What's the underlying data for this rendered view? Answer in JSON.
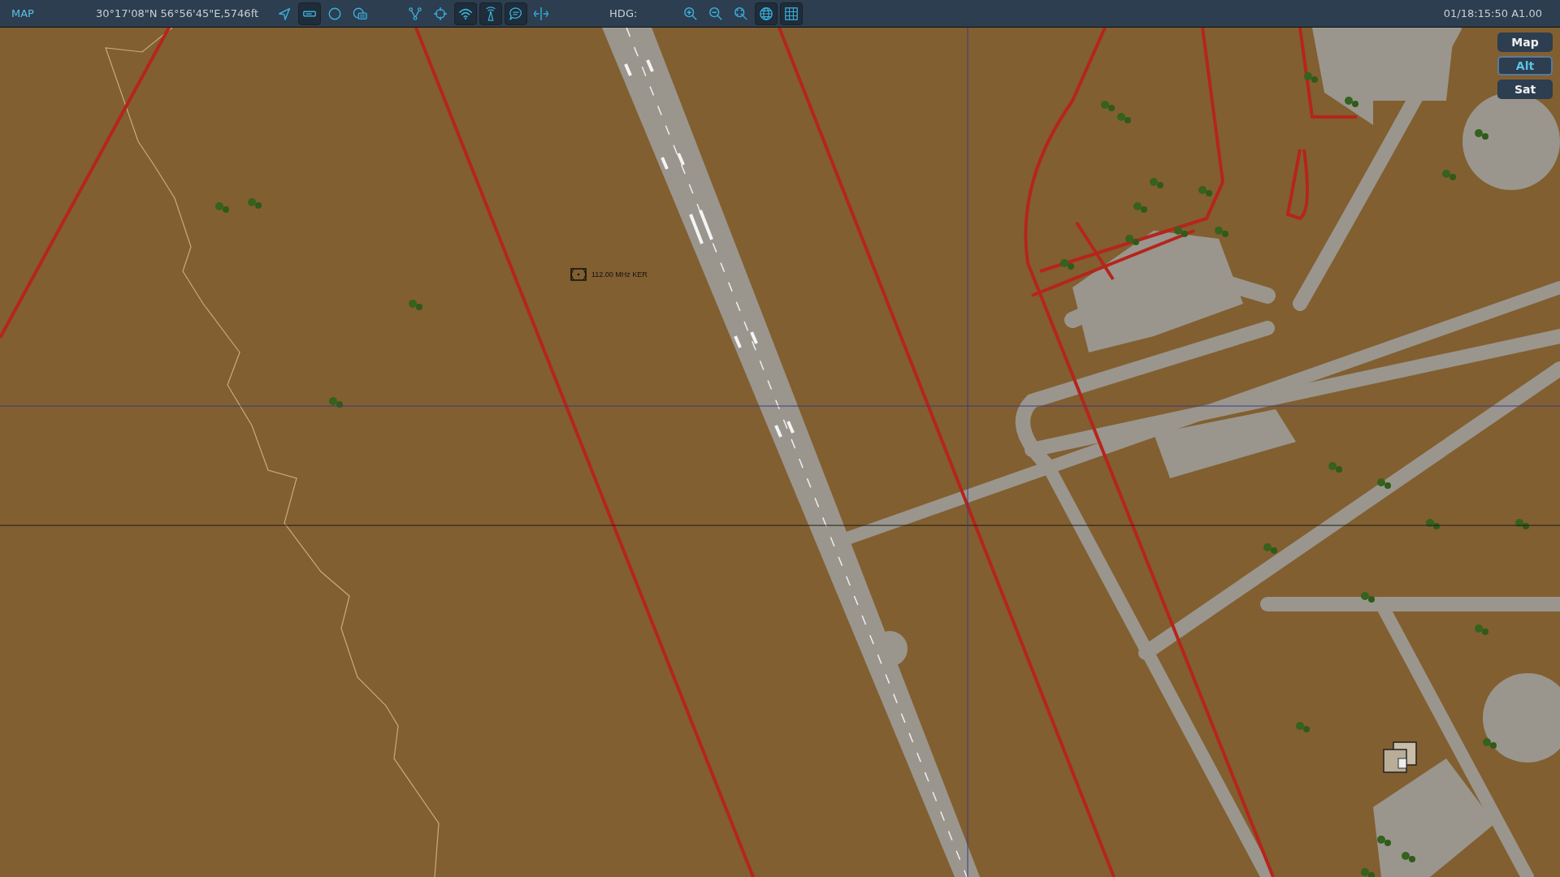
{
  "toolbar": {
    "title": "MAP",
    "coordinates": "30°17'08\"N 56°56'45\"E,5746ft",
    "tools": [
      {
        "kind": "navigate",
        "on": false
      },
      {
        "kind": "ruler",
        "on": true
      },
      {
        "kind": "circle",
        "on": false
      },
      {
        "kind": "layers",
        "on": false
      },
      {
        "kind": "branch",
        "on": false
      },
      {
        "kind": "crosshair",
        "on": false
      },
      {
        "kind": "wifi",
        "on": true
      },
      {
        "kind": "tower",
        "on": true
      },
      {
        "kind": "chat",
        "on": true
      },
      {
        "kind": "split",
        "on": false
      }
    ],
    "heading_label": "HDG:",
    "view_tools": [
      {
        "kind": "zoom-in",
        "on": false
      },
      {
        "kind": "zoom-out",
        "on": false
      },
      {
        "kind": "zoom-fit",
        "on": false
      },
      {
        "kind": "globe",
        "on": true
      },
      {
        "kind": "grid",
        "on": true
      }
    ],
    "datetime": "01/18:15:50 A1.00"
  },
  "map_layers": [
    {
      "label": "Map",
      "selected": false
    },
    {
      "label": "Alt",
      "selected": true
    },
    {
      "label": "Sat",
      "selected": false
    }
  ],
  "beacon": {
    "label": "112.00 MHz KER"
  }
}
